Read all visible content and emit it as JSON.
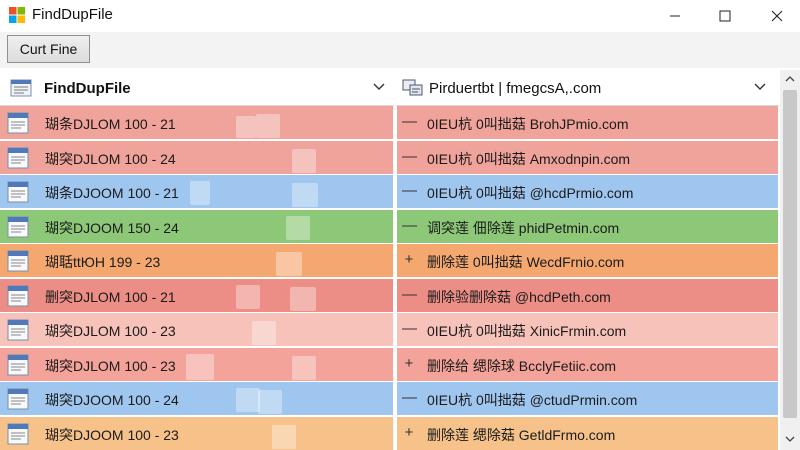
{
  "window": {
    "title": "FindDupFile",
    "logo_icon": "windows-logo-icon",
    "controls": [
      "minimize-icon",
      "maximize-icon",
      "close-icon"
    ]
  },
  "toolbar": {
    "button_label": "Curt Fine"
  },
  "left_header": {
    "label": "FindDupFile",
    "icon": "list-icon",
    "dropdown_icon": "chevron-down-icon"
  },
  "right_header": {
    "label": "Pirduertbt | fmegcsA,.com",
    "icon": "network-icon",
    "dropdown_icon": "chevron-down-icon"
  },
  "rows": [
    {
      "left": "瑚条DJLOM 100 - 21",
      "mark": "—",
      "right": "0IEU杭 0叫拙菇 BrohJPmio.com",
      "color": "#f0a39a"
    },
    {
      "left": "瑚突DJLOM 100 - 24",
      "mark": "—",
      "right": "0IEU杭 0叫拙菇 Amxodnpin.com",
      "color": "#f0a39a"
    },
    {
      "left": "瑚条DJOOM 100 - 21",
      "mark": "—",
      "right": "0IEU杭 0叫拙菇 @hcdPrmio.com",
      "color": "#9fc6ef"
    },
    {
      "left": "瑚突DJOOM 150 - 24",
      "mark": "—",
      "right": "调突莲 佃除莲 phidPetmin.com",
      "color": "#8cc877"
    },
    {
      "left": "瑚聒ttЮH 199 - 23",
      "mark": "+",
      "right": "删除莲 0叫拙菇 WecdFrnio.com",
      "color": "#f4a870"
    },
    {
      "left": "删突DJLOM 100 - 21",
      "mark": "—",
      "right": "删除验删除菇 @hcdPeth.com",
      "color": "#ec8e86"
    },
    {
      "left": "瑚突DJLOM 100 - 23",
      "mark": "—",
      "right": "0IEU杭 0叫拙菇 XinicFrmin.com",
      "color": "#f6c2b9"
    },
    {
      "left": "瑚突DJLOM 100 - 23",
      "mark": "+",
      "right": "删除给 缌除球 BcclyFetiic.com",
      "color": "#f4a39a"
    },
    {
      "left": "瑚突DJOOM 100 - 24",
      "mark": "—",
      "right": "0IEU杭 0叫拙菇 @ctudPrmin.com",
      "color": "#9fc6ef"
    },
    {
      "left": "瑚突DJOOM 100 - 23",
      "mark": "+",
      "right": "删除莲 缌除菇 GetldFrmo.com",
      "color": "#f6c28a"
    }
  ]
}
